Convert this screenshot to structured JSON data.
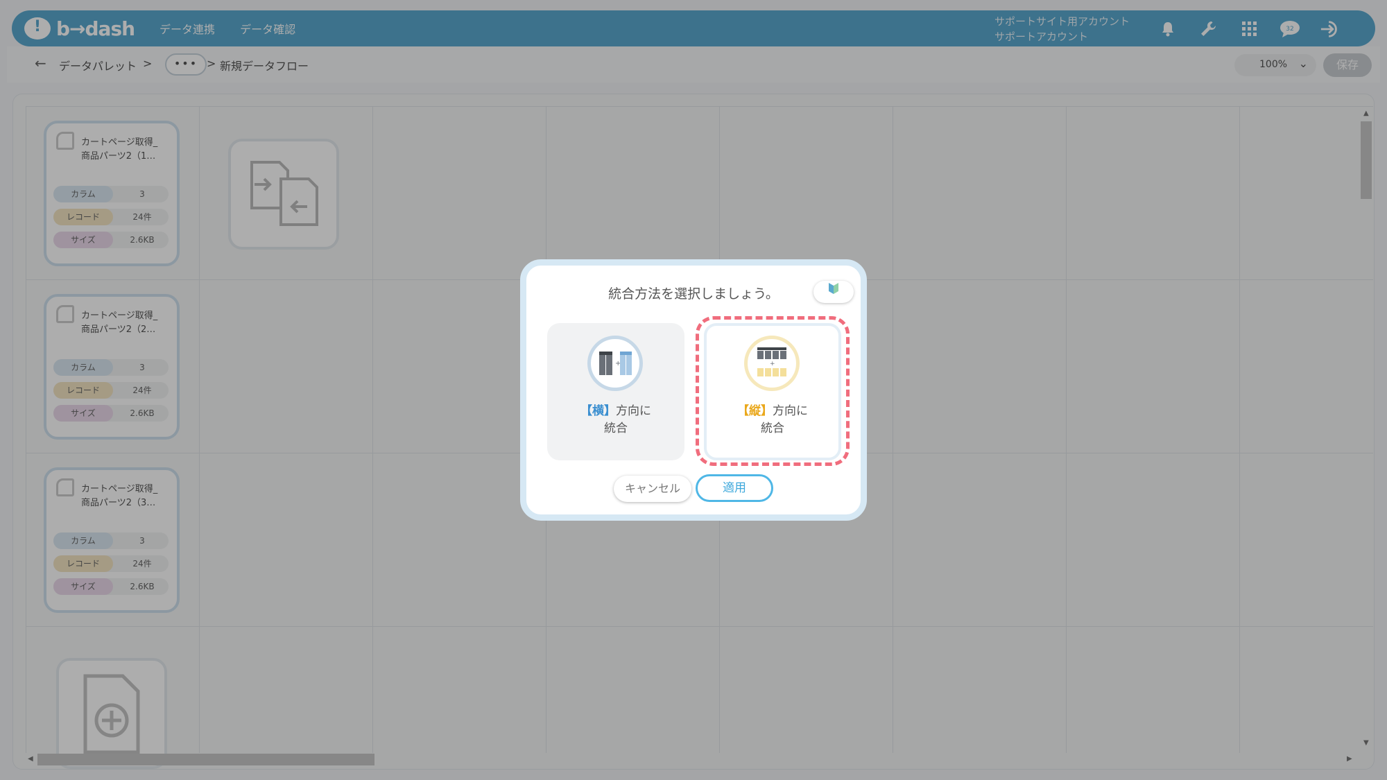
{
  "header": {
    "logo_text": "b→dash",
    "nav": [
      "データ連携",
      "データ確認"
    ],
    "account_line1": "サポートサイト用アカウント",
    "account_line2": "サポートアカウント",
    "icons": [
      "bell-icon",
      "wrench-icon",
      "apps-grid-icon",
      "chat-icon",
      "logout-icon"
    ]
  },
  "toolbar": {
    "back": "←",
    "crumb1": "データパレット",
    "sep": ">",
    "dots": "•••",
    "crumb2": "新規データフロー",
    "zoom": "100%",
    "save": "保存"
  },
  "nodes": [
    {
      "title1": "カートページ取得_",
      "title2": "商品パーツ2（1…",
      "col_label": "カラム",
      "col": "3",
      "rec_label": "レコード",
      "rec": "24件",
      "size_label": "サイズ",
      "size": "2.6KB"
    },
    {
      "title1": "カートページ取得_",
      "title2": "商品パーツ2（2…",
      "col_label": "カラム",
      "col": "3",
      "rec_label": "レコード",
      "rec": "24件",
      "size_label": "サイズ",
      "size": "2.6KB"
    },
    {
      "title1": "カートページ取得_",
      "title2": "商品パーツ2（3…",
      "col_label": "カラム",
      "col": "3",
      "rec_label": "レコード",
      "rec": "24件",
      "size_label": "サイズ",
      "size": "2.6KB"
    }
  ],
  "dialog": {
    "title": "統合方法を選択しましょう。",
    "help_icon": "beginner-mark-icon",
    "option_horizontal": {
      "bracket": "【横】",
      "rest1": "方向に",
      "rest2": "統合"
    },
    "option_vertical": {
      "bracket": "【縦】",
      "rest1": "方向に",
      "rest2": "統合"
    },
    "cancel": "キャンセル",
    "apply": "適用"
  },
  "colors": {
    "header": "#5aa9cf",
    "accent_blue": "#3b8fd0",
    "accent_yellow": "#eaa81c",
    "highlight": "#f06d7d",
    "apply": "#4fb7e6"
  }
}
